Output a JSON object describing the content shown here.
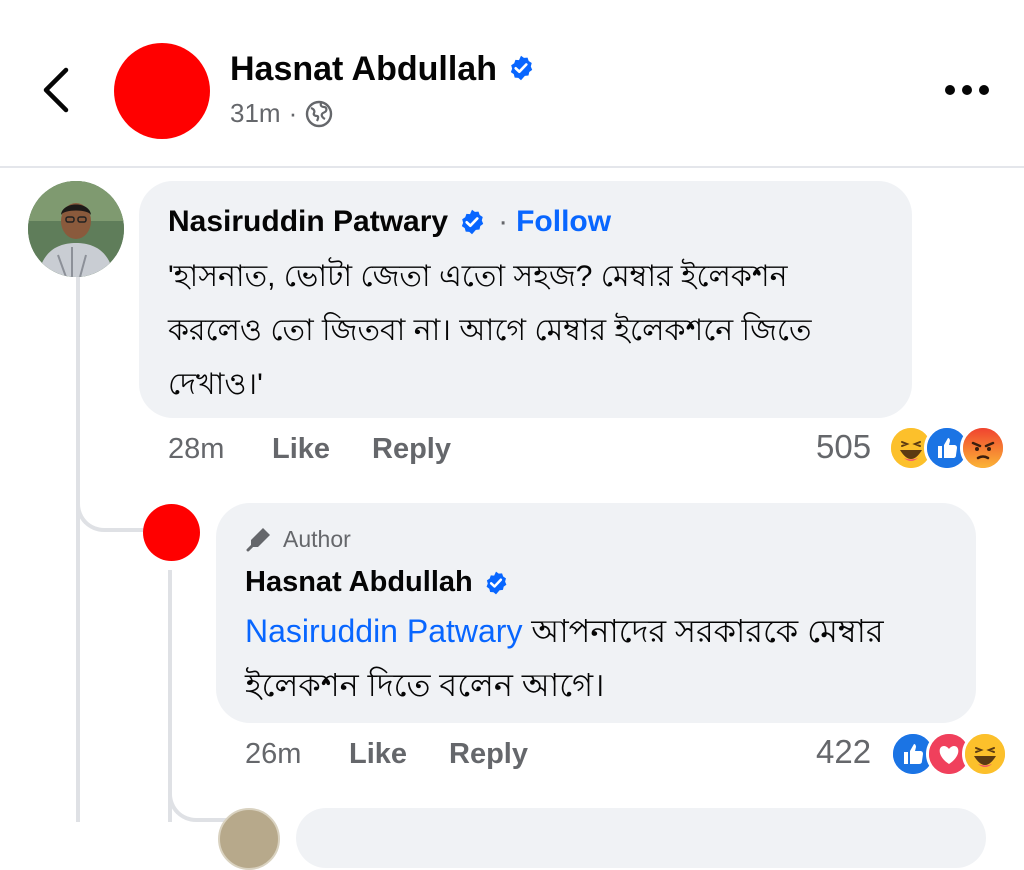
{
  "header": {
    "name": "Hasnat Abdullah",
    "time": "31m",
    "dot": "·"
  },
  "comment1": {
    "author": "Nasiruddin Patwary",
    "separator": "·",
    "follow_label": "Follow",
    "text": "'হাসনাত, ভোটা জেতা এতো সহজ? মেম্বার ইলেকশন করলেও তো জিতবা না। আগে মেম্বার ইলেকশনে জিতে দেখাও।'",
    "time": "28m",
    "like_label": "Like",
    "reply_label": "Reply",
    "reaction_count": "505",
    "reactions": [
      "haha-icon",
      "like-icon",
      "angry-icon"
    ]
  },
  "comment2": {
    "badge": "Author",
    "author": "Hasnat Abdullah",
    "mention": "Nasiruddin Patwary",
    "text": " আপনাদের সরকারকে মেম্বার ইলেকশন দিতে বলেন আগে।",
    "time": "26m",
    "like_label": "Like",
    "reply_label": "Reply",
    "reaction_count": "422",
    "reactions": [
      "like-icon",
      "love-icon",
      "haha-icon"
    ]
  },
  "colors": {
    "accent": "#0866ff",
    "secondary_text": "#65676b",
    "bubble": "#f0f2f5",
    "avatar_red": "#ff0000"
  }
}
